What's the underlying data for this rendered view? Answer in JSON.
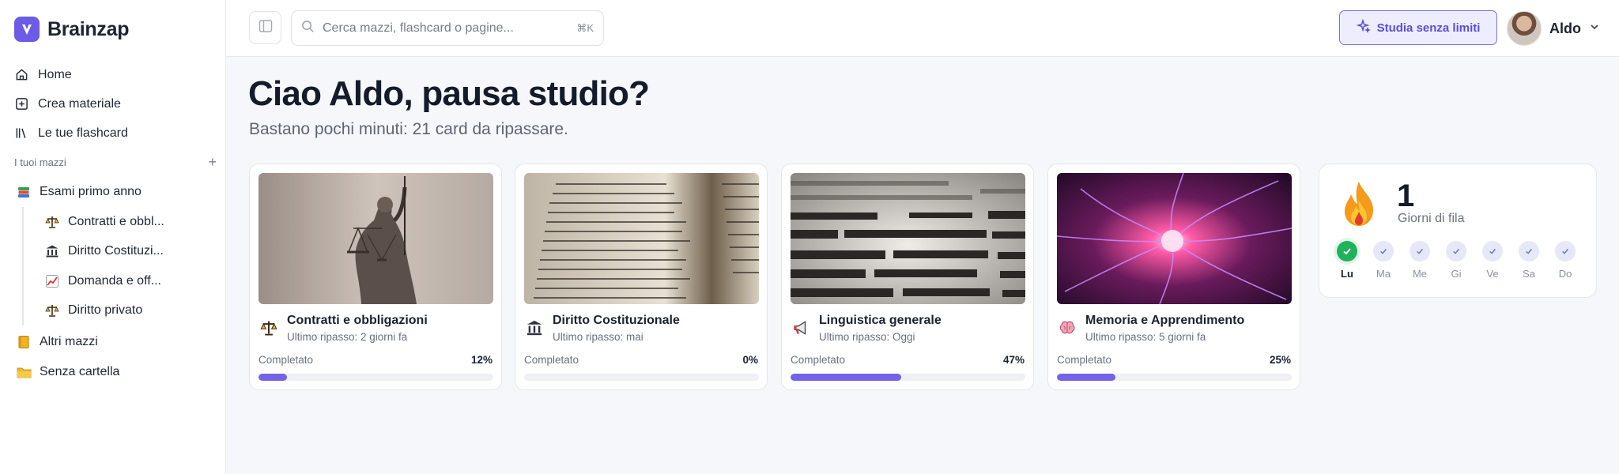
{
  "app": {
    "name": "Brainzap"
  },
  "nav": [
    {
      "label": "Home",
      "icon": "home-icon"
    },
    {
      "label": "Crea materiale",
      "icon": "plus-square-icon"
    },
    {
      "label": "Le tue flashcard",
      "icon": "books-icon"
    }
  ],
  "decks_section": {
    "title": "I tuoi mazzi"
  },
  "folders": {
    "first": {
      "label": "Esami primo anno",
      "icon": "books-stack-icon"
    },
    "children": [
      {
        "label": "Contratti e obbl...",
        "icon": "scales-icon"
      },
      {
        "label": "Diritto Costituzi...",
        "icon": "classical-building-icon"
      },
      {
        "label": "Domanda e off...",
        "icon": "chart-icon"
      },
      {
        "label": "Diritto privato",
        "icon": "scales-icon"
      }
    ],
    "other": {
      "label": "Altri mazzi",
      "icon": "notebook-icon"
    },
    "none": {
      "label": "Senza cartella",
      "icon": "folder-icon"
    }
  },
  "topbar": {
    "search_placeholder": "Cerca mazzi, flashcard o pagine...",
    "shortcut": "⌘K",
    "upgrade_label": "Studia senza limiti",
    "user_name": "Aldo"
  },
  "main": {
    "greeting": "Ciao Aldo, pausa studio?",
    "subtitle": "Bastano pochi minuti: 21 card da ripassare."
  },
  "decks": [
    {
      "title": "Contratti e obbligazioni",
      "last_review": "Ultimo ripasso: 2 giorni fa",
      "completed_label": "Completato",
      "percent_label": "12%",
      "progress": 0.12,
      "icon": "scales-icon",
      "image": "justice-statue"
    },
    {
      "title": "Diritto Costituzionale",
      "last_review": "Ultimo ripasso: mai",
      "completed_label": "Completato",
      "percent_label": "0%",
      "progress": 0.0,
      "icon": "classical-building-icon",
      "image": "open-book"
    },
    {
      "title": "Linguistica generale",
      "last_review": "Ultimo ripasso: Oggi",
      "completed_label": "Completato",
      "percent_label": "47%",
      "progress": 0.47,
      "icon": "megaphone-icon",
      "image": "dictionary-page"
    },
    {
      "title": "Memoria e Apprendimento",
      "last_review": "Ultimo ripasso: 5 giorni fa",
      "completed_label": "Completato",
      "percent_label": "25%",
      "progress": 0.25,
      "icon": "brain-icon",
      "image": "plasma-ball"
    }
  ],
  "streak": {
    "count": "1",
    "label": "Giorni di fila",
    "days": [
      {
        "label": "Lu",
        "done": true
      },
      {
        "label": "Ma",
        "done": false
      },
      {
        "label": "Me",
        "done": false
      },
      {
        "label": "Gi",
        "done": false
      },
      {
        "label": "Ve",
        "done": false
      },
      {
        "label": "Sa",
        "done": false
      },
      {
        "label": "Do",
        "done": false
      }
    ]
  },
  "colors": {
    "accent": "#6b5be6",
    "progress": "#7463e8",
    "success": "#1fb25a"
  }
}
